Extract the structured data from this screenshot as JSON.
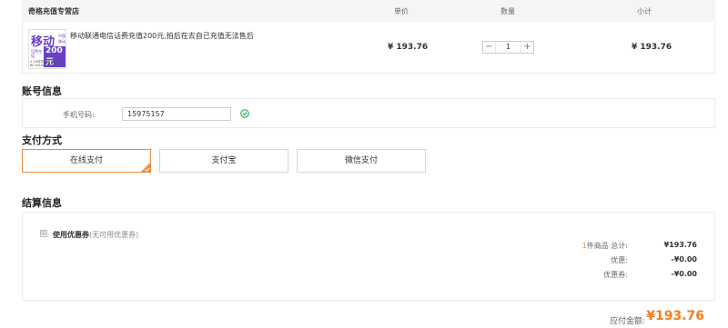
{
  "cart": {
    "store_name": "奇格充值专营店",
    "columns": {
      "price": "单价",
      "quantity": "数量",
      "subtotal": "小计"
    },
    "item": {
      "thumbnail": {
        "main_text": "移动",
        "tag_text": "中国移动",
        "small_text": "话费充值",
        "amount": "200元",
        "footer_text": "0-24时内到账 请核对号码 ONLINE TOP-UP"
      },
      "title": "移动联通电信话费充值200元,拍后在去自己充值无法售后",
      "unit_price": "¥ 193.76",
      "quantity": "1",
      "minus": "−",
      "plus": "+",
      "subtotal": "¥ 193.76"
    }
  },
  "account": {
    "title": "账号信息",
    "phone_label": "手机号码:",
    "phone_value": "15975157",
    "valid_icon": "check-circle-icon",
    "valid_color": "#2db24a"
  },
  "payment": {
    "title": "支付方式",
    "accent_color": "#f08a3a",
    "options": [
      {
        "label": "在线支付",
        "selected": true
      },
      {
        "label": "支付宝",
        "selected": false
      },
      {
        "label": "微信支付",
        "selected": false
      }
    ]
  },
  "settlement": {
    "title": "结算信息",
    "coupon_toggle": "⊞",
    "coupon_label": "使用优惠券",
    "coupon_note": "(无可用优惠券)",
    "rows": [
      {
        "count": "1",
        "label": "件商品  总计:",
        "value": "¥193.76"
      },
      {
        "label": "优惠:",
        "value": "-¥0.00"
      },
      {
        "label": "优惠券:",
        "value": "-¥0.00"
      }
    ],
    "total_label": "应付金额:",
    "total_value": "¥193.76",
    "total_color": "#f57c1f"
  }
}
